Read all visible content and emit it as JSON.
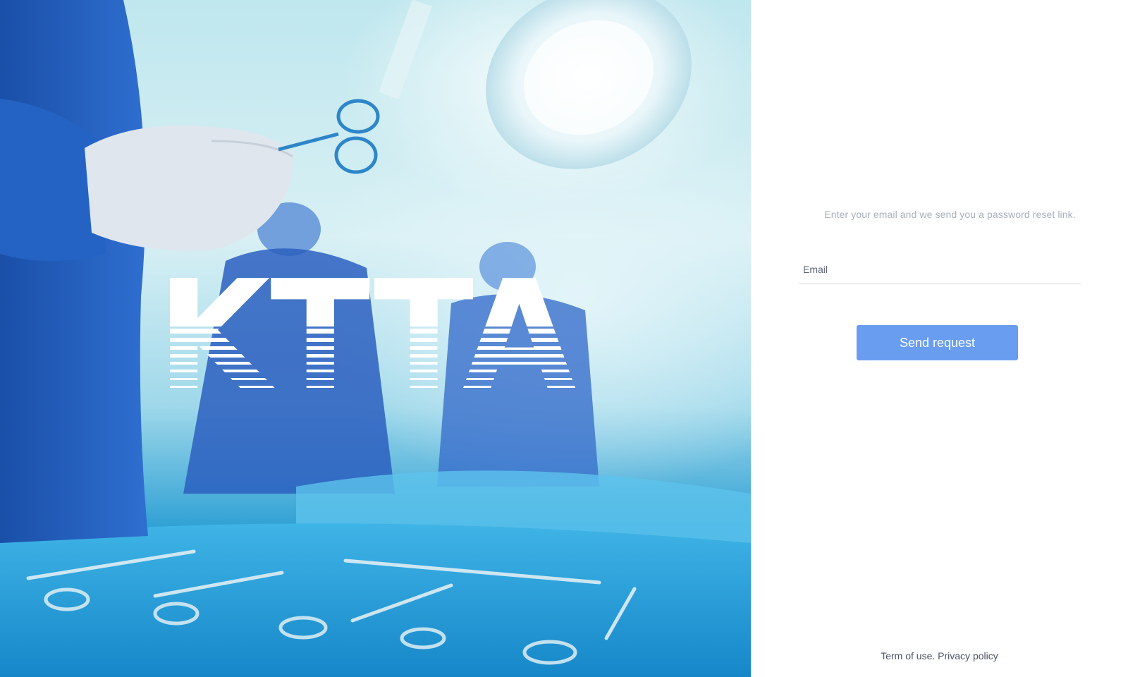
{
  "brand": {
    "logo_text": "KTTA",
    "logo_color": "#ffffff"
  },
  "hero": {
    "image_subject": "surgeons-in-operating-room",
    "accent_color": "#1f8fcf"
  },
  "reset_form": {
    "instructions": "Enter your email and we send you a password reset link.",
    "email": {
      "placeholder": "Email",
      "value": ""
    },
    "submit_label": "Send request",
    "button_color": "#689df0"
  },
  "footer": {
    "terms_label": "Term of use.",
    "privacy_label": "Privacy policy"
  }
}
